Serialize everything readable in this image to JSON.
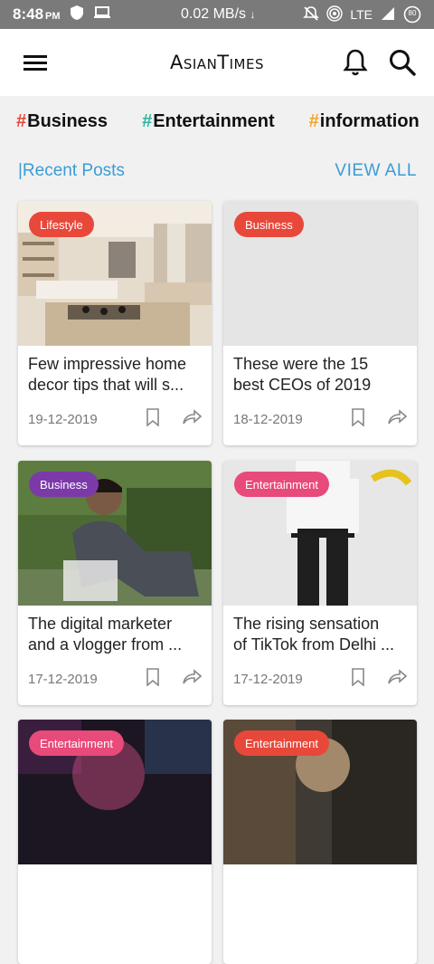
{
  "status": {
    "time": "8:48",
    "ampm": "PM",
    "speed": "0.02 MB/s",
    "network": "LTE",
    "battery": "80"
  },
  "app": {
    "brand": "AsianTimes"
  },
  "hashtags": [
    {
      "hash": "#",
      "label": "Business",
      "color": "#e8483a"
    },
    {
      "hash": "#",
      "label": "Entertainment",
      "color": "#2bb5a0"
    },
    {
      "hash": "#",
      "label": "information",
      "color": "#f2a52e"
    }
  ],
  "section": {
    "title": "|Recent Posts",
    "view_all": "VIEW ALL"
  },
  "posts": [
    {
      "category": "Lifestyle",
      "category_color": "#e8483a",
      "title_l1": "Few impressive home",
      "title_l2": "decor tips that will s...",
      "date": "19-12-2019"
    },
    {
      "category": "Business",
      "category_color": "#e8483a",
      "title_l1": "These were the 15",
      "title_l2": "best CEOs of 2019",
      "date": "18-12-2019"
    },
    {
      "category": "Business",
      "category_color": "#7b3aa8",
      "title_l1": "The digital marketer",
      "title_l2": "and a vlogger from ...",
      "date": "17-12-2019"
    },
    {
      "category": "Entertainment",
      "category_color": "#e84a7a",
      "title_l1": "The rising sensation",
      "title_l2": "of TikTok from Delhi ...",
      "date": "17-12-2019"
    },
    {
      "category": "Entertainment",
      "category_color": "#e84a7a",
      "title_l1": "",
      "title_l2": "",
      "date": ""
    },
    {
      "category": "Entertainment",
      "category_color": "#e8483a",
      "title_l1": "",
      "title_l2": "",
      "date": ""
    }
  ],
  "colors": {
    "accent": "#3b9bd6",
    "background": "#f1f1f1",
    "status_bar": "#7a7a7a"
  }
}
